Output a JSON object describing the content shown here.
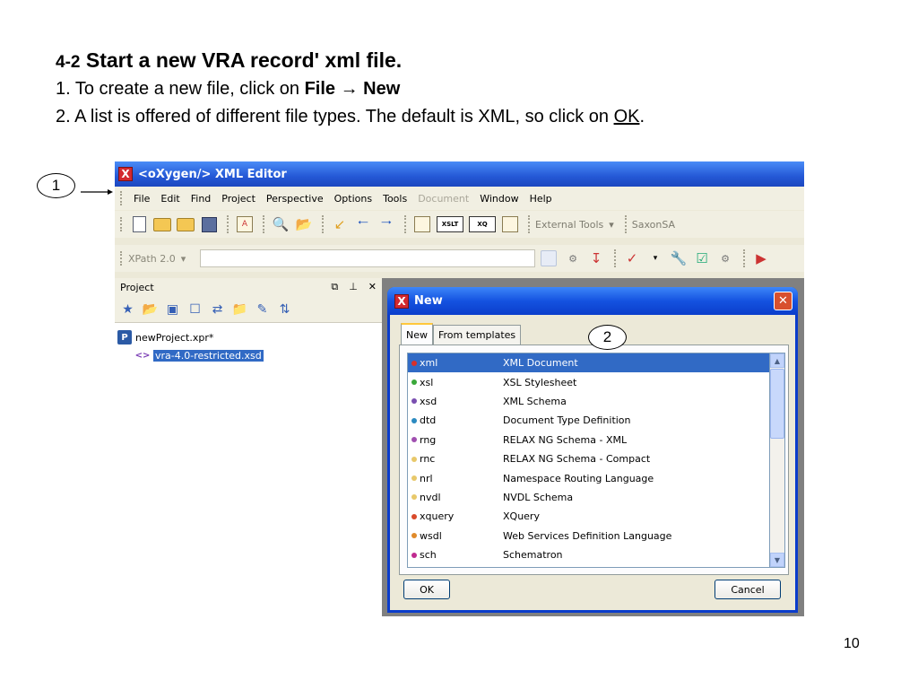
{
  "slide": {
    "title_number": "4-2",
    "title_text": "Start a new VRA record' xml file.",
    "step1_prefix": "1. To create a new file, click on ",
    "step1_file": "File",
    "step1_arrow": "→",
    "step1_new": "New",
    "step2_prefix": "2. A list is offered of different file types.  The default is XML, so click on ",
    "step2_ok": "OK",
    "step2_suffix": ".",
    "page_number": "10"
  },
  "callouts": {
    "one": "1",
    "two": "2"
  },
  "app": {
    "title": "<oXygen/> XML Editor",
    "menu": [
      "File",
      "Edit",
      "Find",
      "Project",
      "Perspective",
      "Options",
      "Tools",
      "Document",
      "Window",
      "Help"
    ],
    "toolbar": {
      "external_tools": "External Tools",
      "saxon": "SaxonSA",
      "xpath": "XPath 2.0"
    }
  },
  "project_panel": {
    "title": "Project",
    "project_file": "newProject.xpr*",
    "child_file": "vra-4.0-restricted.xsd"
  },
  "dialog": {
    "title": "New",
    "tabs": [
      "New",
      "From templates"
    ],
    "file_types": [
      {
        "ext": "xml",
        "desc": "XML Document",
        "color": "#d9302a"
      },
      {
        "ext": "xsl",
        "desc": "XSL Stylesheet",
        "color": "#3aa83a"
      },
      {
        "ext": "xsd",
        "desc": "XML Schema",
        "color": "#7a4fb0"
      },
      {
        "ext": "dtd",
        "desc": "Document Type Definition",
        "color": "#2a8ac0"
      },
      {
        "ext": "rng",
        "desc": "RELAX NG Schema - XML",
        "color": "#a04fb0"
      },
      {
        "ext": "rnc",
        "desc": "RELAX NG Schema - Compact",
        "color": "#e8c86a"
      },
      {
        "ext": "nrl",
        "desc": "Namespace Routing Language",
        "color": "#e8c86a"
      },
      {
        "ext": "nvdl",
        "desc": "NVDL Schema",
        "color": "#e8c86a"
      },
      {
        "ext": "xquery",
        "desc": "XQuery",
        "color": "#d94a2a"
      },
      {
        "ext": "wsdl",
        "desc": "Web Services Definition Language",
        "color": "#e08a2a"
      },
      {
        "ext": "sch",
        "desc": "Schematron",
        "color": "#c02a90"
      }
    ],
    "ok_label": "OK",
    "cancel_label": "Cancel"
  }
}
